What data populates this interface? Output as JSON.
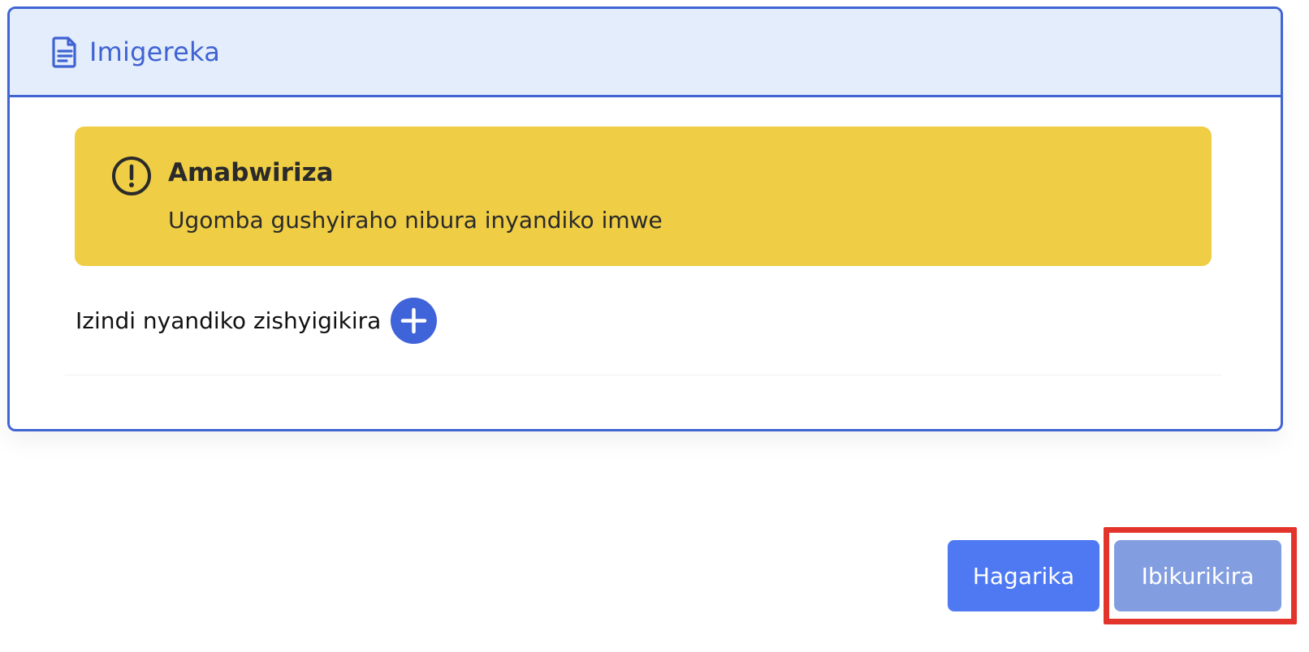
{
  "panel": {
    "title": "Imigereka",
    "icon": "document-icon"
  },
  "alert": {
    "title": "Amabwiriza",
    "message": "Ugomba gushyiraho nibura inyandiko imwe",
    "icon": "warning-circle-icon",
    "background_color": "#efcd44"
  },
  "documents": {
    "label": "Izindi nyandiko zishyigikira",
    "add_icon": "plus-circle-icon"
  },
  "actions": {
    "cancel_label": "Hagarika",
    "next_label": "Ibikurikira"
  },
  "colors": {
    "accent": "#4164d4",
    "header_background": "#e4edfb",
    "cancel_button": "#4e79f3",
    "next_button": "#839ee0",
    "highlight": "#e2342a"
  }
}
